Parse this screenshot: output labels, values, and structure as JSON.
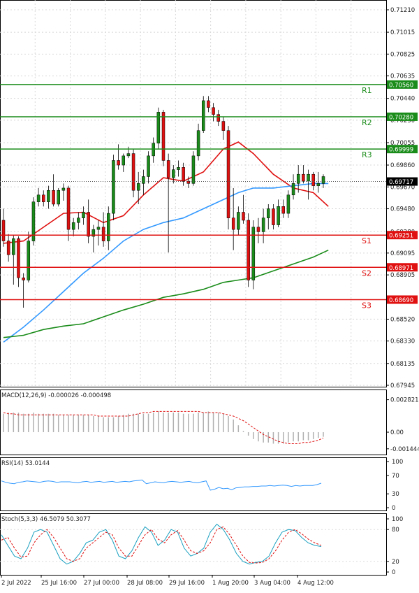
{
  "chart_data": {
    "type": "candlestick",
    "price_axis": {
      "ticks": [
        "0.71210",
        "0.71015",
        "0.70825",
        "0.70635",
        "0.70440",
        "0.70250",
        "0.70055",
        "0.69860",
        "0.69670",
        "0.69480",
        "0.69280",
        "0.69095",
        "0.68905",
        "0.68520",
        "0.68330",
        "0.68135",
        "0.67945"
      ],
      "ylim": [
        0.67945,
        0.7121
      ]
    },
    "current_price": {
      "label": "0.69717",
      "value": 0.69717
    },
    "levels": [
      {
        "name": "R1",
        "value": 0.7056,
        "label": "0.70560",
        "color": "#1a8c1a"
      },
      {
        "name": "R2",
        "value": 0.7028,
        "label": "0.70280",
        "color": "#1a8c1a"
      },
      {
        "name": "R3",
        "value": 0.69999,
        "label": "0.69999",
        "color": "#1a8c1a"
      },
      {
        "name": "S1",
        "value": 0.69251,
        "label": "0.69251",
        "color": "#e01010"
      },
      {
        "name": "S2",
        "value": 0.68971,
        "label": "0.68971",
        "color": "#e01010"
      },
      {
        "name": "S3",
        "value": 0.6869,
        "label": "0.68690",
        "color": "#e01010"
      }
    ],
    "candles": [
      [
        0.6938,
        0.6948,
        0.6915,
        0.692
      ],
      [
        0.692,
        0.6926,
        0.6902,
        0.6908
      ],
      [
        0.6908,
        0.6925,
        0.6882,
        0.6922
      ],
      [
        0.6922,
        0.6924,
        0.688,
        0.6888
      ],
      [
        0.6888,
        0.6892,
        0.6862,
        0.6886
      ],
      [
        0.6886,
        0.6928,
        0.6884,
        0.692
      ],
      [
        0.692,
        0.6958,
        0.6916,
        0.6954
      ],
      [
        0.6954,
        0.6966,
        0.695,
        0.696
      ],
      [
        0.696,
        0.6964,
        0.695,
        0.6954
      ],
      [
        0.6954,
        0.6968,
        0.6948,
        0.6964
      ],
      [
        0.6964,
        0.6978,
        0.695,
        0.6952
      ],
      [
        0.6952,
        0.6966,
        0.695,
        0.6964
      ],
      [
        0.6964,
        0.697,
        0.6955,
        0.6966
      ],
      [
        0.6966,
        0.6968,
        0.692,
        0.693
      ],
      [
        0.693,
        0.694,
        0.6924,
        0.6936
      ],
      [
        0.6936,
        0.6945,
        0.693,
        0.694
      ],
      [
        0.694,
        0.695,
        0.6934,
        0.6945
      ],
      [
        0.6945,
        0.6956,
        0.6918,
        0.6924
      ],
      [
        0.6924,
        0.6934,
        0.691,
        0.693
      ],
      [
        0.693,
        0.6938,
        0.6916,
        0.6932
      ],
      [
        0.6932,
        0.6945,
        0.6915,
        0.692
      ],
      [
        0.692,
        0.695,
        0.6912,
        0.6944
      ],
      [
        0.6944,
        0.6995,
        0.6938,
        0.699
      ],
      [
        0.699,
        0.7004,
        0.6982,
        0.6986
      ],
      [
        0.6986,
        0.6996,
        0.698,
        0.6994
      ],
      [
        0.6994,
        0.7002,
        0.6992,
        0.6996
      ],
      [
        0.6996,
        0.7,
        0.6958,
        0.6964
      ],
      [
        0.6964,
        0.698,
        0.6952,
        0.697
      ],
      [
        0.697,
        0.6982,
        0.696,
        0.6976
      ],
      [
        0.6976,
        0.6998,
        0.697,
        0.6994
      ],
      [
        0.6994,
        0.701,
        0.6988,
        0.7005
      ],
      [
        0.7005,
        0.7036,
        0.7,
        0.7032
      ],
      [
        0.7032,
        0.7034,
        0.6985,
        0.699
      ],
      [
        0.699,
        0.6996,
        0.691,
        0.6975
      ],
      [
        0.6975,
        0.6986,
        0.697,
        0.6982
      ],
      [
        0.6982,
        0.699,
        0.6976,
        0.6984
      ],
      [
        0.6984,
        0.6988,
        0.6968,
        0.6972
      ],
      [
        0.6972,
        0.6976,
        0.6966,
        0.697
      ],
      [
        0.697,
        0.6998,
        0.6968,
        0.6994
      ],
      [
        0.6994,
        0.7022,
        0.699,
        0.7016
      ],
      [
        0.7016,
        0.7046,
        0.7014,
        0.7042
      ],
      [
        0.7042,
        0.7046,
        0.7032,
        0.7036
      ],
      [
        0.7036,
        0.704,
        0.7024,
        0.703
      ],
      [
        0.703,
        0.7034,
        0.702,
        0.7024
      ],
      [
        0.7024,
        0.7028,
        0.7008,
        0.7016
      ],
      [
        0.7016,
        0.702,
        0.693,
        0.694
      ],
      [
        0.694,
        0.6966,
        0.6912,
        0.693
      ],
      [
        0.693,
        0.695,
        0.6925,
        0.6945
      ],
      [
        0.6945,
        0.696,
        0.6935,
        0.6938
      ],
      [
        0.6938,
        0.6944,
        0.688,
        0.6886
      ],
      [
        0.6886,
        0.6938,
        0.6878,
        0.6932
      ],
      [
        0.6932,
        0.694,
        0.6918,
        0.6928
      ],
      [
        0.6928,
        0.6948,
        0.6918,
        0.694
      ],
      [
        0.694,
        0.6952,
        0.693,
        0.6948
      ],
      [
        0.6948,
        0.6952,
        0.693,
        0.6934
      ],
      [
        0.6934,
        0.6956,
        0.6932,
        0.695
      ],
      [
        0.695,
        0.6956,
        0.694,
        0.6944
      ],
      [
        0.6944,
        0.6964,
        0.694,
        0.696
      ],
      [
        0.696,
        0.6978,
        0.6956,
        0.697
      ],
      [
        0.697,
        0.6986,
        0.6962,
        0.6978
      ],
      [
        0.6978,
        0.6986,
        0.697,
        0.6972
      ],
      [
        0.6972,
        0.6982,
        0.6956,
        0.6978
      ],
      [
        0.6978,
        0.698,
        0.6964,
        0.6968
      ],
      [
        0.6968,
        0.698,
        0.6962,
        0.697
      ],
      [
        0.697,
        0.6978,
        0.6966,
        0.6976
      ]
    ],
    "moving_averages": [
      {
        "color": "#e01010",
        "values": [
          [
            0,
            0.6918
          ],
          [
            4,
            0.692
          ],
          [
            8,
            0.6932
          ],
          [
            12,
            0.6944
          ],
          [
            16,
            0.6945
          ],
          [
            20,
            0.6936
          ],
          [
            24,
            0.6942
          ],
          [
            28,
            0.696
          ],
          [
            32,
            0.6975
          ],
          [
            36,
            0.6972
          ],
          [
            40,
            0.698
          ],
          [
            44,
            0.7
          ],
          [
            47,
            0.7006
          ],
          [
            50,
            0.6996
          ],
          [
            54,
            0.6978
          ],
          [
            58,
            0.6966
          ],
          [
            62,
            0.6962
          ],
          [
            65,
            0.695
          ]
        ]
      },
      {
        "color": "#3399ff",
        "values": [
          [
            0,
            0.6832
          ],
          [
            4,
            0.6845
          ],
          [
            8,
            0.686
          ],
          [
            12,
            0.6876
          ],
          [
            16,
            0.6892
          ],
          [
            20,
            0.6905
          ],
          [
            24,
            0.692
          ],
          [
            28,
            0.693
          ],
          [
            32,
            0.6936
          ],
          [
            36,
            0.694
          ],
          [
            40,
            0.6948
          ],
          [
            44,
            0.6956
          ],
          [
            47,
            0.6962
          ],
          [
            50,
            0.6966
          ],
          [
            54,
            0.6966
          ],
          [
            58,
            0.6968
          ],
          [
            62,
            0.697
          ],
          [
            65,
            0.697
          ]
        ]
      },
      {
        "color": "#1a8c1a",
        "values": [
          [
            0,
            0.6836
          ],
          [
            4,
            0.6838
          ],
          [
            8,
            0.6843
          ],
          [
            12,
            0.6846
          ],
          [
            16,
            0.6848
          ],
          [
            20,
            0.6854
          ],
          [
            24,
            0.686
          ],
          [
            28,
            0.6865
          ],
          [
            32,
            0.6871
          ],
          [
            36,
            0.6874
          ],
          [
            40,
            0.6878
          ],
          [
            44,
            0.6884
          ],
          [
            47,
            0.6886
          ],
          [
            50,
            0.6888
          ],
          [
            54,
            0.6894
          ],
          [
            58,
            0.69
          ],
          [
            62,
            0.6906
          ],
          [
            65,
            0.6912
          ]
        ]
      }
    ],
    "x_labels": [
      "2 Jul 2022",
      "25 Jul 16:00",
      "27 Jul 00:00",
      "28 Jul 08:00",
      "29 Jul 16:00",
      "1 Aug 20:00",
      "3 Aug 04:00",
      "4 Aug 12:00"
    ],
    "macd": {
      "title": "MACD(12,26,9) -0.000026 -0.000498",
      "ticks": [
        "0.002821",
        "0.00",
        "-0.001444"
      ],
      "ylim": [
        -0.0017,
        0.0031
      ],
      "signal_color": "#e01010",
      "histogram": [
        0.0016,
        0.0017,
        0.0017,
        0.0017,
        0.0016,
        0.0016,
        0.0017,
        0.0016,
        0.0016,
        0.0016,
        0.0016,
        0.0015,
        0.0015,
        0.0015,
        0.0015,
        0.0015,
        0.0015,
        0.0015,
        0.0014,
        0.0014,
        0.0013,
        0.0013,
        0.0013,
        0.0014,
        0.0015,
        0.0016,
        0.0016,
        0.0016,
        0.0016,
        0.0016,
        0.0017,
        0.0018,
        0.0017,
        0.0017,
        0.0017,
        0.0017,
        0.0016,
        0.0016,
        0.0016,
        0.0017,
        0.0017,
        0.0018,
        0.0017,
        0.0017,
        0.0016,
        0.0014,
        0.0011,
        0.0006,
        0.0001,
        -0.0003,
        -0.0006,
        -0.0008,
        -0.0009,
        -0.0009,
        -0.001,
        -0.001,
        -0.001,
        -0.0009,
        -0.0008,
        -0.0008,
        -0.0007,
        -0.0007,
        -0.0006,
        -0.0005,
        -0.0004
      ],
      "signal": [
        0.0017,
        0.0016,
        0.0016,
        0.0015,
        0.0015,
        0.0015,
        0.0015,
        0.0015,
        0.0015,
        0.0015,
        0.0015,
        0.0015,
        0.0015,
        0.0015,
        0.0015,
        0.0015,
        0.0015,
        0.0015,
        0.0015,
        0.0014,
        0.0014,
        0.0014,
        0.0014,
        0.0014,
        0.0014,
        0.0014,
        0.0015,
        0.0016,
        0.0017,
        0.0017,
        0.0018,
        0.0018,
        0.0018,
        0.0018,
        0.0018,
        0.0018,
        0.0018,
        0.0018,
        0.0018,
        0.0018,
        0.0017,
        0.0017,
        0.0017,
        0.0017,
        0.0016,
        0.0015,
        0.0014,
        0.0012,
        0.001,
        0.0007,
        0.0004,
        0.0001,
        -0.0002,
        -0.0004,
        -0.0006,
        -0.0008,
        -0.0009,
        -0.001,
        -0.001,
        -0.001,
        -0.0009,
        -0.0009,
        -0.0008,
        -0.0007,
        -0.0005
      ]
    },
    "rsi": {
      "title": "RSI(14) 53.0144",
      "ticks": [
        "100",
        "70",
        "30",
        "0"
      ],
      "ylim": [
        0,
        100
      ],
      "line_color": "#3399ff",
      "values": [
        58,
        55,
        53,
        52,
        55,
        56,
        58,
        57,
        56,
        55,
        57,
        58,
        57,
        55,
        56,
        56,
        56,
        55,
        54,
        56,
        57,
        55,
        56,
        57,
        55,
        56,
        57,
        55,
        56,
        57,
        56,
        58,
        59,
        60,
        52,
        54,
        56,
        55,
        54,
        56,
        57,
        56,
        55,
        56,
        57,
        55,
        54,
        56,
        58,
        38,
        40,
        44,
        41,
        42,
        39,
        43,
        44,
        45,
        45,
        46,
        46,
        47,
        47,
        48,
        47,
        48,
        49,
        48,
        46,
        48,
        47,
        48,
        48,
        48,
        50,
        53
      ]
    },
    "stoch": {
      "title": "Stoch(5,3,3) 46.5079 50.3077",
      "ticks": [
        "100",
        "80",
        "20",
        "0"
      ],
      "ylim": [
        0,
        100
      ],
      "k_color": "#1aa0c0",
      "d_color": "#e01010",
      "k": [
        70,
        50,
        30,
        25,
        45,
        75,
        80,
        75,
        50,
        25,
        15,
        20,
        35,
        55,
        60,
        75,
        80,
        60,
        30,
        25,
        40,
        65,
        85,
        75,
        50,
        60,
        80,
        75,
        45,
        30,
        35,
        45,
        75,
        90,
        80,
        60,
        35,
        20,
        15,
        18,
        20,
        30,
        55,
        75,
        80,
        78,
        65,
        55,
        50,
        48
      ],
      "d": [
        60,
        65,
        45,
        28,
        30,
        55,
        70,
        80,
        65,
        45,
        25,
        20,
        25,
        45,
        55,
        65,
        75,
        70,
        45,
        30,
        30,
        50,
        70,
        80,
        62,
        55,
        70,
        78,
        60,
        40,
        35,
        40,
        55,
        80,
        85,
        70,
        50,
        30,
        18,
        17,
        18,
        25,
        40,
        60,
        75,
        80,
        72,
        62,
        55,
        50
      ]
    }
  }
}
